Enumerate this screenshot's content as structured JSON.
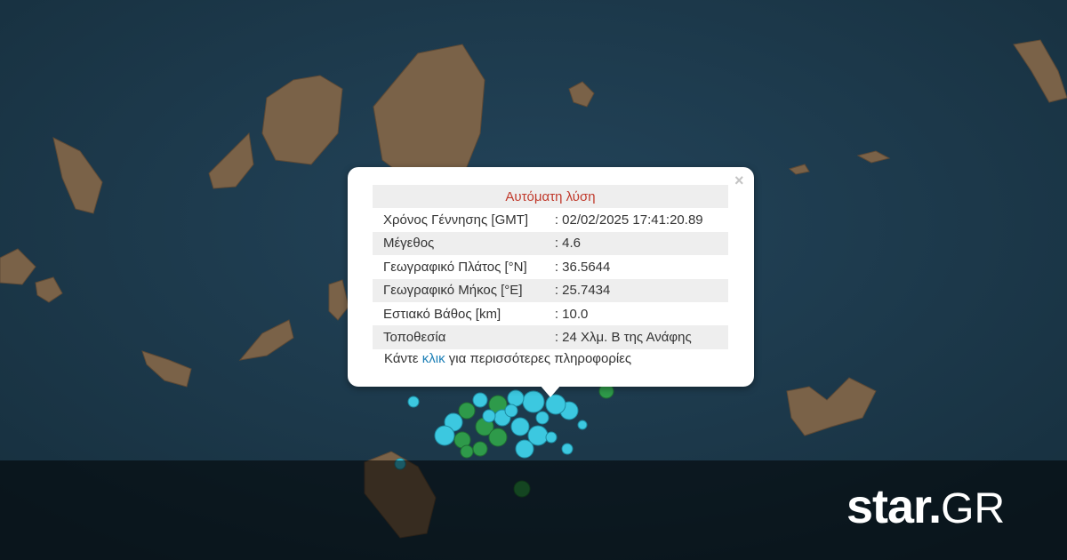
{
  "popup": {
    "title": "Αυτόματη λύση",
    "rows": [
      {
        "label": "Χρόνος Γέννησης [GMT]",
        "value": ": 02/02/2025 17:41:20.89"
      },
      {
        "label": "Μέγεθος",
        "value": ": 4.6"
      },
      {
        "label": "Γεωγραφικό Πλάτος [°N]",
        "value": ": 36.5644"
      },
      {
        "label": "Γεωγραφικό Μήκος [°E]",
        "value": ": 25.7434"
      },
      {
        "label": "Εστιακό Βάθος [km]",
        "value": ": 10.0"
      },
      {
        "label": "Τοποθεσία",
        "value": ": 24 Χλμ. Β της Ανάφης"
      }
    ],
    "footer_pre": "Κάντε ",
    "footer_link": "κλικ",
    "footer_post": " για περισσότερες πληροφορίες",
    "close_icon": "×"
  },
  "logo": {
    "main": "star",
    "dot": ".",
    "suffix": "GR"
  },
  "colors": {
    "sea": "#1c3a4f",
    "land": "#7a6248",
    "quake_cyan": "#3cc8e0",
    "quake_green": "#2e9a4a",
    "title_red": "#c0392b",
    "link_blue": "#1c7fb6"
  }
}
